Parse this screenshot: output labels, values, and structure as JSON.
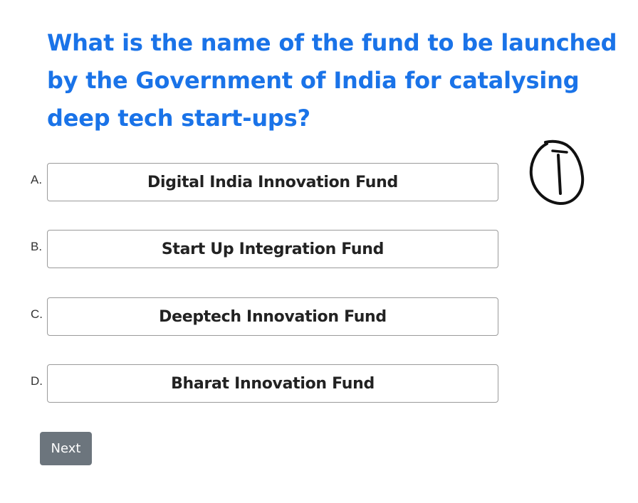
{
  "question": {
    "text": "What is the name of the fund to be launched by the Government of India for catalysing deep tech start-ups?"
  },
  "options": [
    {
      "letter": "A.",
      "label": "Digital India Innovation Fund"
    },
    {
      "letter": "B.",
      "label": "Start Up Integration Fund"
    },
    {
      "letter": "C.",
      "label": "Deeptech Innovation Fund"
    },
    {
      "letter": "D.",
      "label": "Bharat Innovation Fund"
    }
  ],
  "navigation": {
    "next_label": "Next"
  },
  "annotation": {
    "icon": "handwritten-circled-one-icon",
    "meaning": "1"
  },
  "colors": {
    "question_text": "#1a73e8",
    "next_button_bg": "#6c757d",
    "option_border": "#9a9a9a"
  }
}
